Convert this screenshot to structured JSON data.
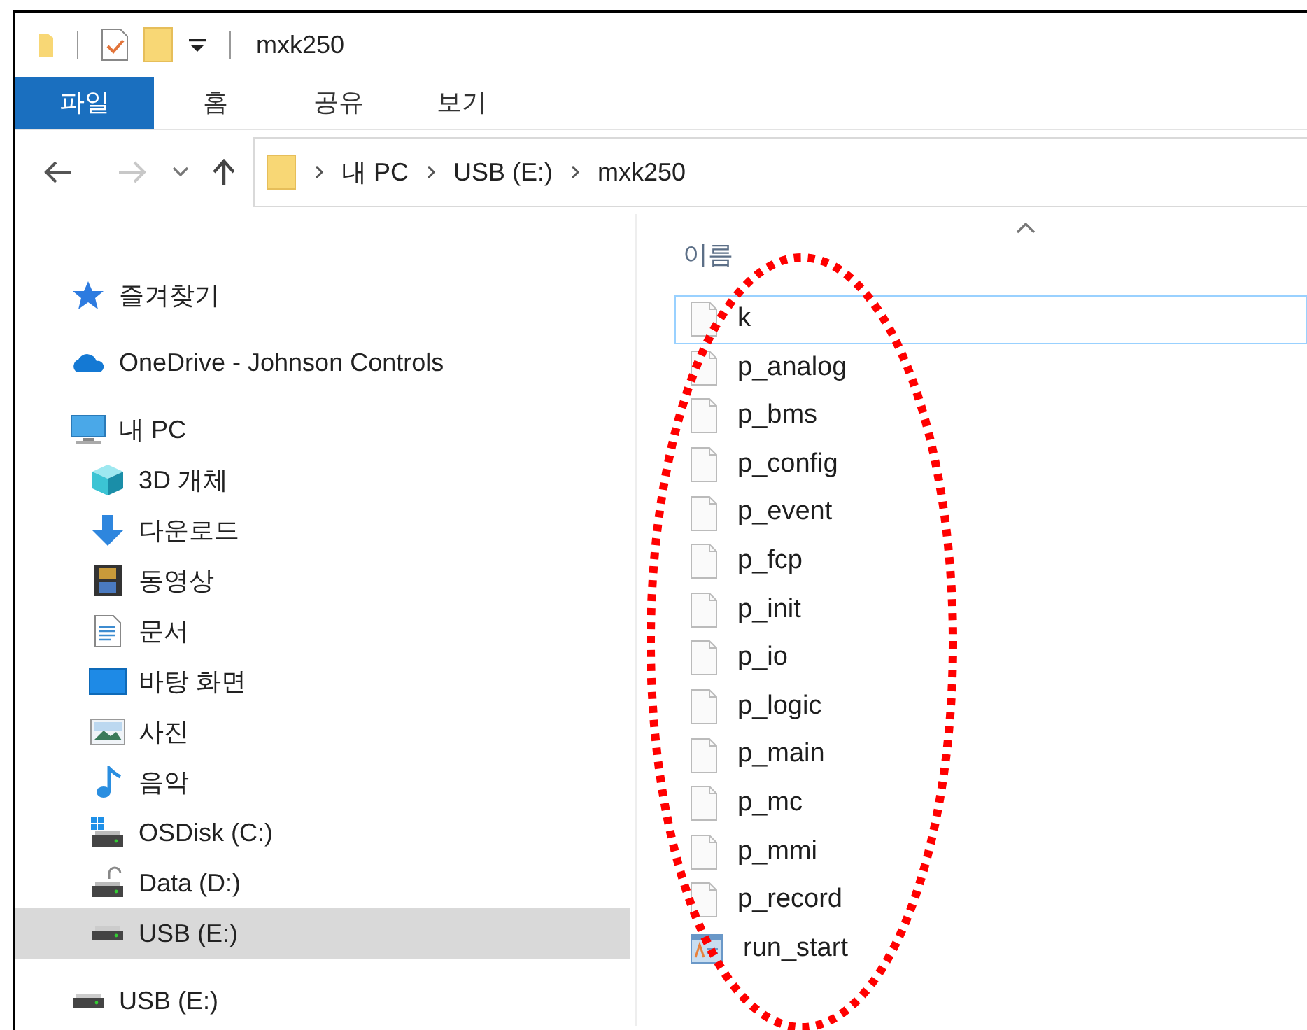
{
  "quick_access": {
    "items": [
      {
        "kind": "folder"
      },
      {
        "kind": "checklist"
      },
      {
        "kind": "folder"
      },
      {
        "kind": "customize"
      }
    ]
  },
  "window": {
    "title": "mxk250"
  },
  "tabs": [
    {
      "label": "파일",
      "selected": true
    },
    {
      "label": "홈",
      "selected": false
    },
    {
      "label": "공유",
      "selected": false
    },
    {
      "label": "보기",
      "selected": false
    }
  ],
  "nav": {
    "back_disabled": false,
    "forward_disabled": true
  },
  "address": {
    "segments": [
      "내 PC",
      "USB (E:)",
      "mxk250"
    ]
  },
  "sidebar": {
    "items": [
      {
        "label": "즐겨찾기",
        "kind": "star",
        "selected": false
      },
      {
        "label": "OneDrive - Johnson Controls",
        "kind": "cloud",
        "selected": false
      },
      {
        "label": "내 PC",
        "kind": "pc",
        "selected": false,
        "children": [
          {
            "label": "3D 개체",
            "kind": "cube",
            "selected": false
          },
          {
            "label": "다운로드",
            "kind": "download",
            "selected": false
          },
          {
            "label": "동영상",
            "kind": "film",
            "selected": false
          },
          {
            "label": "문서",
            "kind": "doc",
            "selected": false
          },
          {
            "label": "바탕 화면",
            "kind": "desktop",
            "selected": false
          },
          {
            "label": "사진",
            "kind": "photo",
            "selected": false
          },
          {
            "label": "음악",
            "kind": "music",
            "selected": false
          },
          {
            "label": "OSDisk (C:)",
            "kind": "osdisk",
            "selected": false
          },
          {
            "label": "Data (D:)",
            "kind": "disk",
            "selected": false
          },
          {
            "label": "USB (E:)",
            "kind": "usb",
            "selected": true
          }
        ]
      },
      {
        "label": "USB (E:)",
        "kind": "usb",
        "selected": false
      }
    ]
  },
  "file_list": {
    "column": "이름",
    "rows": [
      {
        "name": "k",
        "kind": "file",
        "focused": true
      },
      {
        "name": "p_analog",
        "kind": "file",
        "focused": false
      },
      {
        "name": "p_bms",
        "kind": "file",
        "focused": false
      },
      {
        "name": "p_config",
        "kind": "file",
        "focused": false
      },
      {
        "name": "p_event",
        "kind": "file",
        "focused": false
      },
      {
        "name": "p_fcp",
        "kind": "file",
        "focused": false
      },
      {
        "name": "p_init",
        "kind": "file",
        "focused": false
      },
      {
        "name": "p_io",
        "kind": "file",
        "focused": false
      },
      {
        "name": "p_logic",
        "kind": "file",
        "focused": false
      },
      {
        "name": "p_main",
        "kind": "file",
        "focused": false
      },
      {
        "name": "p_mc",
        "kind": "file",
        "focused": false
      },
      {
        "name": "p_mmi",
        "kind": "file",
        "focused": false
      },
      {
        "name": "p_record",
        "kind": "file",
        "focused": false
      },
      {
        "name": "run_start",
        "kind": "app",
        "focused": false
      }
    ]
  }
}
